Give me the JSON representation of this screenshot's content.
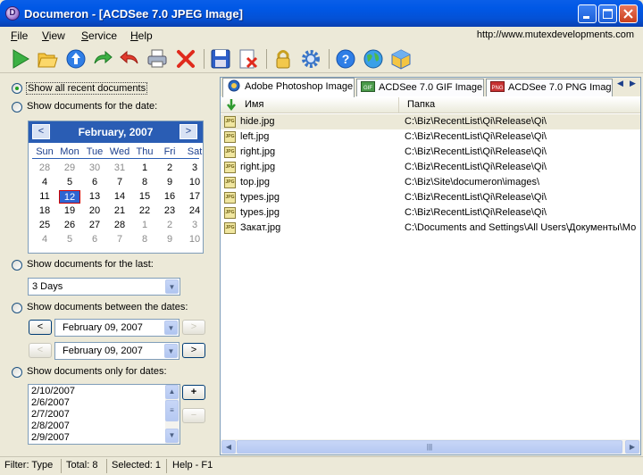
{
  "window": {
    "title": "Documeron - [ACDSee 7.0 JPEG Image]",
    "app_icon_letter": "D"
  },
  "menu": [
    {
      "label": "File",
      "key": "F",
      "rest": "ile"
    },
    {
      "label": "View",
      "key": "V",
      "rest": "iew"
    },
    {
      "label": "Service",
      "key": "S",
      "rest": "ervice"
    },
    {
      "label": "Help",
      "key": "H",
      "rest": "elp"
    }
  ],
  "url": "http://www.mutexdevelopments.com",
  "toolbar": [
    "play-icon",
    "open-folder-icon",
    "info-icon",
    "forward-icon",
    "back-icon",
    "print-icon",
    "delete-icon",
    "save-icon",
    "remove-icon",
    "lock-icon",
    "settings-icon",
    "help-icon",
    "globe-icon",
    "cube-icon"
  ],
  "options": {
    "all_recent": "Show all recent documents",
    "for_date": "Show documents for the date:",
    "for_last": "Show documents for the last:",
    "between": "Show documents between the dates:",
    "only_for": "Show documents only for dates:",
    "selected": "all_recent"
  },
  "calendar": {
    "month": "February, 2007",
    "prev": "<",
    "next": ">",
    "days_of_week": [
      "Sun",
      "Mon",
      "Tue",
      "Wed",
      "Thu",
      "Fri",
      "Sat"
    ],
    "weeks": [
      [
        "28",
        "29",
        "30",
        "31",
        "1",
        "2",
        "3"
      ],
      [
        "4",
        "5",
        "6",
        "7",
        "8",
        "9",
        "10"
      ],
      [
        "11",
        "12",
        "13",
        "14",
        "15",
        "16",
        "17"
      ],
      [
        "18",
        "19",
        "20",
        "21",
        "22",
        "23",
        "24"
      ],
      [
        "25",
        "26",
        "27",
        "28",
        "1",
        "2",
        "3"
      ],
      [
        "4",
        "5",
        "6",
        "7",
        "8",
        "9",
        "10"
      ]
    ],
    "selected_day": "12"
  },
  "last_period": {
    "value": "3 Days"
  },
  "between_dates": {
    "from": "February  09, 2007",
    "to": "February  09, 2007",
    "prev_label": "<",
    "next_label": ">"
  },
  "dates_list": {
    "items": [
      "2/10/2007",
      "2/6/2007",
      "2/7/2007",
      "2/8/2007",
      "2/9/2007"
    ],
    "add_label": "+",
    "remove_label": "−"
  },
  "tabs": [
    {
      "label": "Adobe Photoshop Image",
      "icon": "photoshop-icon"
    },
    {
      "label": "ACDSee 7.0 GIF Image",
      "icon": "gif-icon",
      "icon_text": "GIF"
    },
    {
      "label": "ACDSee 7.0 PNG Imag",
      "icon": "png-icon",
      "icon_text": "PNG"
    }
  ],
  "tab_arrows": {
    "left": "◀",
    "right": "▶"
  },
  "columns": {
    "name": "Имя",
    "folder": "Папка"
  },
  "files": [
    {
      "name": "hide.jpg",
      "folder": "C:\\Biz\\RecentList\\Qi\\Release\\Qi\\",
      "selected": true
    },
    {
      "name": "left.jpg",
      "folder": "C:\\Biz\\RecentList\\Qi\\Release\\Qi\\"
    },
    {
      "name": "right.jpg",
      "folder": "C:\\Biz\\RecentList\\Qi\\Release\\Qi\\"
    },
    {
      "name": "right.jpg",
      "folder": "C:\\Biz\\RecentList\\Qi\\Release\\Qi\\"
    },
    {
      "name": "top.jpg",
      "folder": "C:\\Biz\\Site\\documeron\\images\\"
    },
    {
      "name": "types.jpg",
      "folder": "C:\\Biz\\RecentList\\Qi\\Release\\Qi\\"
    },
    {
      "name": "types.jpg",
      "folder": "C:\\Biz\\RecentList\\Qi\\Release\\Qi\\"
    },
    {
      "name": "Закат.jpg",
      "folder": "C:\\Documents and Settings\\All Users\\Документы\\Мо"
    }
  ],
  "file_icon_text": "JPG",
  "status": {
    "filter": "Filter: Type",
    "total": "Total: 8",
    "selected": "Selected: 1",
    "help": "Help - F1"
  },
  "colors": {
    "title_bar": "#0058e6",
    "calendar_header": "#2a5db4",
    "selected_day": "#2e65d2"
  }
}
